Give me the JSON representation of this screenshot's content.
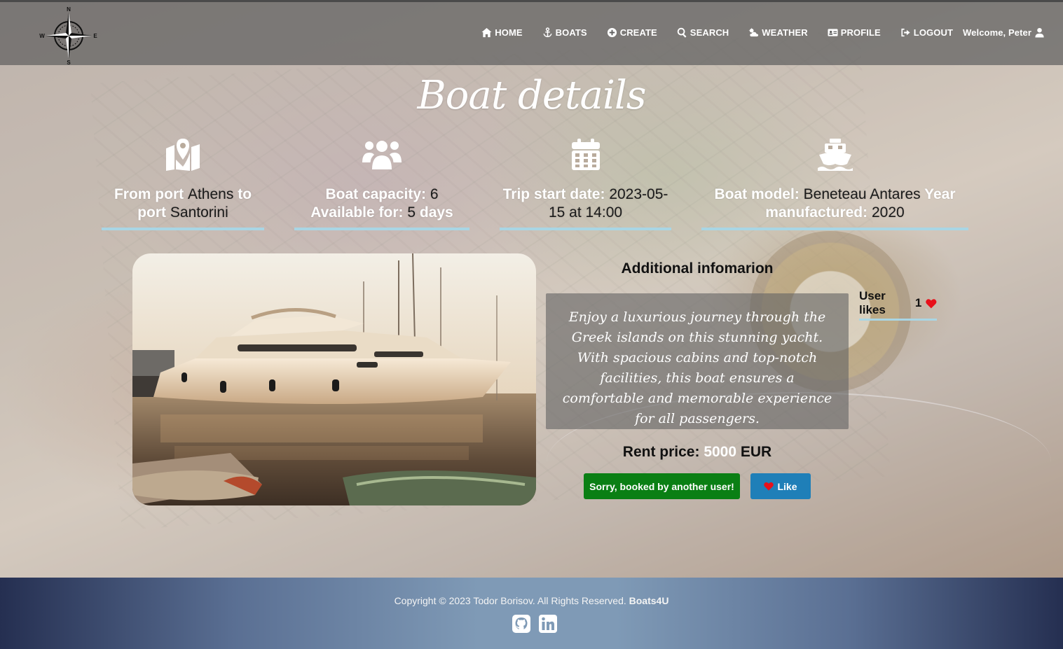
{
  "logo": {
    "compass_letters": {
      "n": "N",
      "s": "S",
      "w": "W",
      "e": "E"
    }
  },
  "nav": {
    "items": [
      {
        "label": "HOME",
        "icon": "home-icon"
      },
      {
        "label": "BOATS",
        "icon": "anchor-icon"
      },
      {
        "label": "CREATE",
        "icon": "plus-circle-icon"
      },
      {
        "label": "SEARCH",
        "icon": "search-icon"
      },
      {
        "label": "WEATHER",
        "icon": "cloud-sun-icon"
      },
      {
        "label": "PROFILE",
        "icon": "id-card-icon"
      },
      {
        "label": "LOGOUT",
        "icon": "logout-icon"
      }
    ],
    "welcome": "Welcome, Peter"
  },
  "page": {
    "title": "Boat details"
  },
  "route": {
    "label_from": "From port",
    "from": "Athens",
    "label_to": "to port",
    "to": "Santorini"
  },
  "capacity": {
    "label": "Boat capacity:",
    "value": "6",
    "available_label": "Available for:",
    "available_value": "5",
    "available_unit": "days"
  },
  "trip": {
    "label": "Trip start date:",
    "date": "2023-05-15",
    "at_label": "at",
    "time": "14:00"
  },
  "boat": {
    "model_label": "Boat model:",
    "model": "Beneteau Antares",
    "year_label": "Year manufactured:",
    "year": "2020"
  },
  "details": {
    "additional_title": "Additional infomarion",
    "likes_label": "User likes",
    "likes_count": "1",
    "description": "Enjoy a luxurious journey through the Greek islands on this stunning yacht. With spacious cabins and top-notch facilities, this boat ensures a comfortable and memorable experience for all passengers.",
    "price_label": "Rent price:",
    "price": "5000",
    "currency": "EUR",
    "booked_button": "Sorry, booked by another user!",
    "like_button": "Like"
  },
  "footer": {
    "copyright": "Copyright © 2023 Todor Borisov. All Rights Reserved.",
    "brand": "Boats4U",
    "socials": [
      "github-icon",
      "linkedin-icon"
    ]
  },
  "colors": {
    "accent_underline": "#a9d6e5",
    "booked_green": "#0a7f14",
    "like_blue": "#1f7fb8",
    "heart_red": "#e8101a"
  }
}
